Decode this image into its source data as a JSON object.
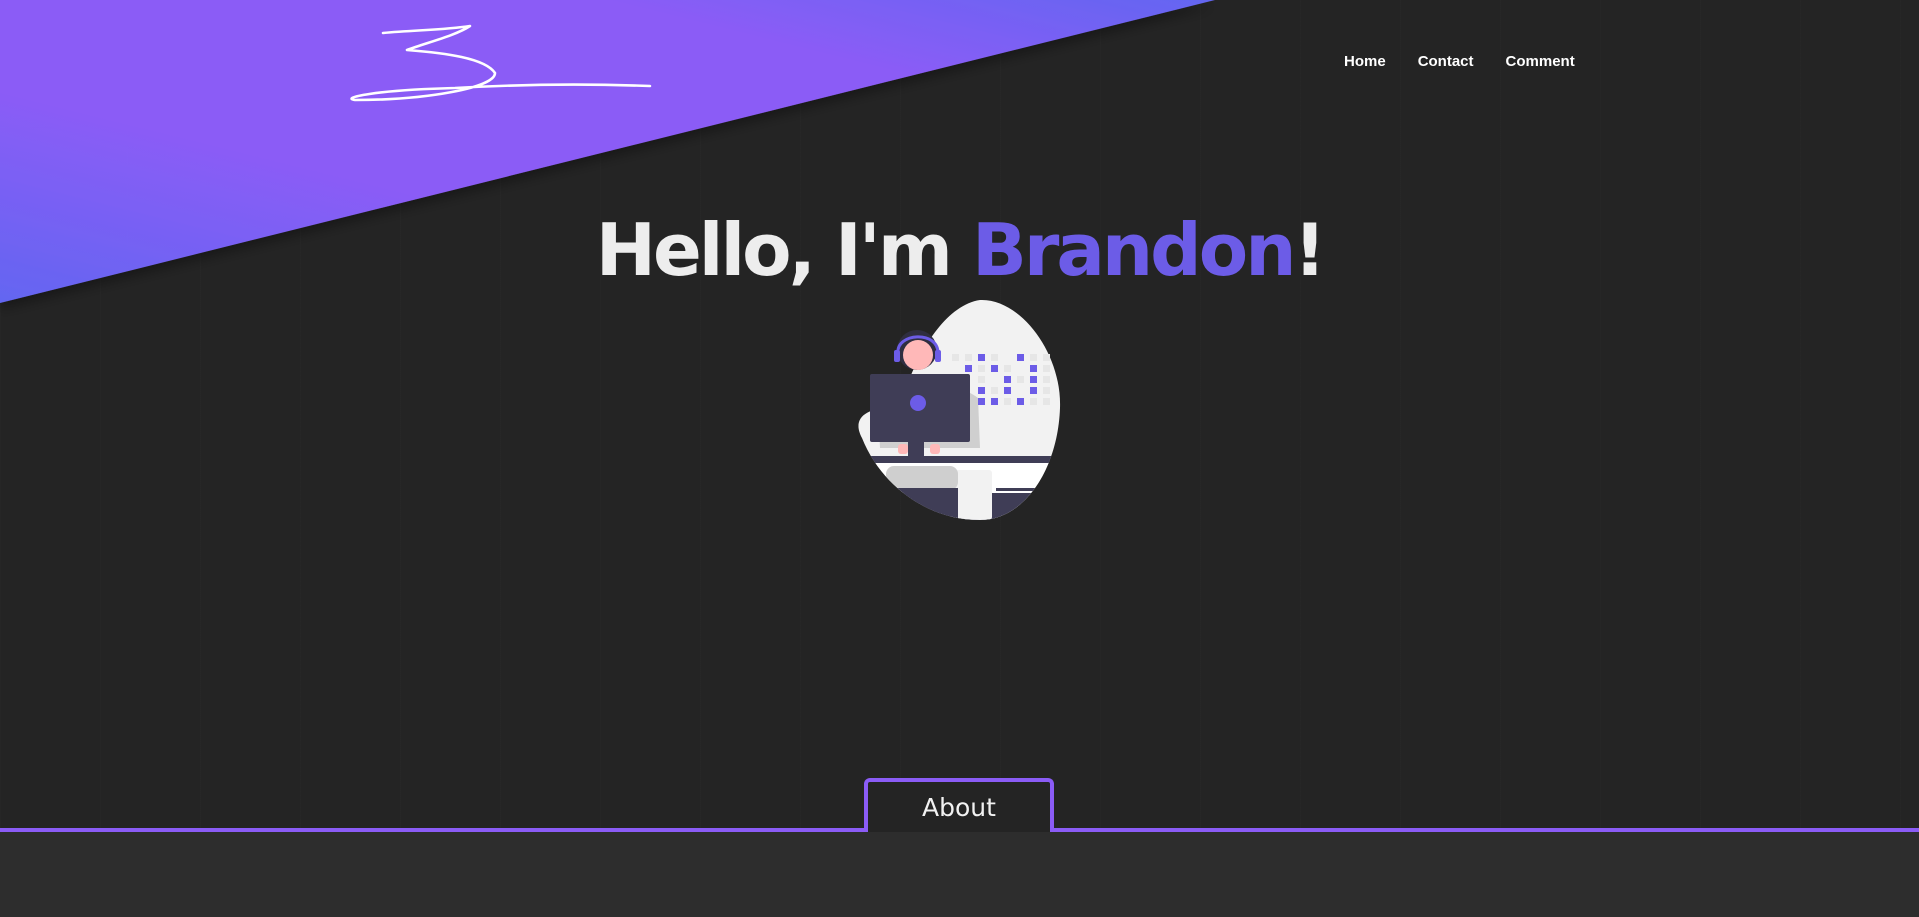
{
  "nav": {
    "items": [
      {
        "label": "Home"
      },
      {
        "label": "Contact"
      },
      {
        "label": "Comment"
      }
    ]
  },
  "hero": {
    "greeting": "Hello, I'm ",
    "name": "Brandon",
    "suffix": "!"
  },
  "section": {
    "tab_label": "About"
  },
  "colors": {
    "accent": "#6c5ce7",
    "gradient_start": "#6366f1",
    "gradient_mid": "#8b5cf6",
    "background": "#242424",
    "section_bg": "#2d2d2d"
  },
  "icons": {
    "logo": "signature-logo",
    "illustration": "person-at-laptop-illustration"
  }
}
